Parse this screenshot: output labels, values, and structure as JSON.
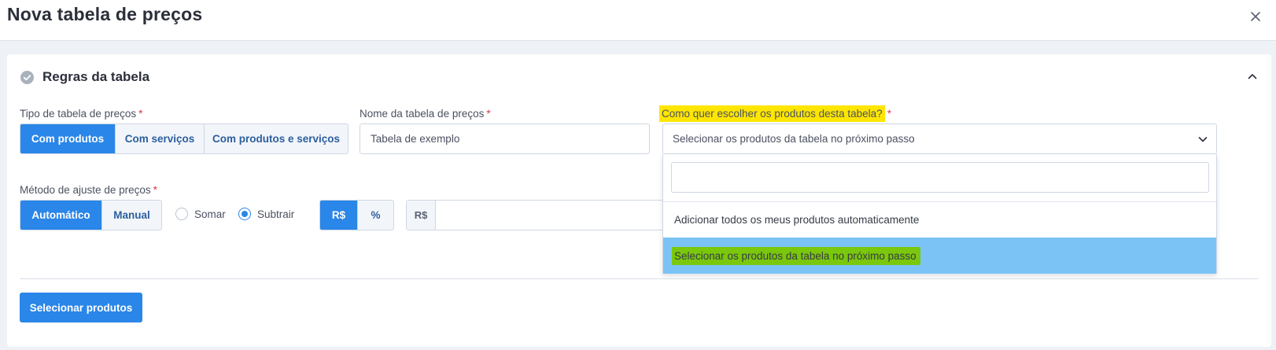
{
  "header": {
    "title": "Nova tabela de preços",
    "close_icon": "close-icon"
  },
  "panel": {
    "title": "Regras da tabela",
    "status_icon": "check-circle-icon",
    "collapse_icon": "chevron-up-icon"
  },
  "tipo_tabela": {
    "label": "Tipo de tabela de preços",
    "required": "*",
    "options": [
      "Com produtos",
      "Com serviços",
      "Com produtos e serviços"
    ],
    "selected": "Com produtos"
  },
  "nome_tabela": {
    "label": "Nome da tabela de preços",
    "required": "*",
    "value": "Tabela de exemplo"
  },
  "escolha_produtos": {
    "label": "Como quer escolher os produtos desta tabela?",
    "required": "*",
    "value": "Selecionar os produtos da tabela no próximo passo",
    "search_value": "",
    "options": [
      "Adicionar todos os meus produtos automaticamente",
      "Selecionar os produtos da tabela no próximo passo"
    ],
    "highlighted_option": "Selecionar os produtos da tabela no próximo passo"
  },
  "metodo_ajuste": {
    "label": "Método de ajuste de preços",
    "required": "*",
    "options": [
      "Automático",
      "Manual"
    ],
    "selected": "Automático",
    "operation": {
      "options": [
        "Somar",
        "Subtrair"
      ],
      "selected": "Subtrair"
    },
    "unit": {
      "options": [
        "R$",
        "%"
      ],
      "selected": "R$"
    },
    "value_prefix": "R$",
    "value": ""
  },
  "footer": {
    "button_label": "Selecionar produtos"
  },
  "colors": {
    "primary": "#2a86e8",
    "label_highlight": "#ffe600",
    "option_highlight": "#7bc3f5",
    "option_text_highlight": "#7ac70c",
    "required": "#e0334b"
  }
}
